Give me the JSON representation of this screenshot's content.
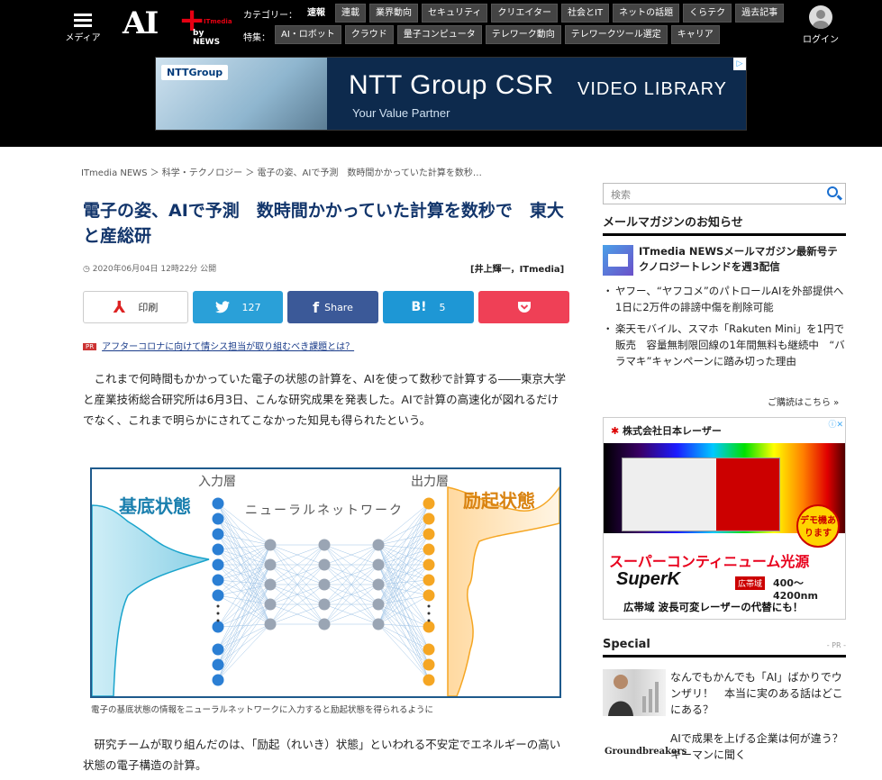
{
  "header": {
    "menu_label": "メディア",
    "logo_text": "AI",
    "logo_plus": "+",
    "logo_itmedia": "ITmedia",
    "logo_by": "by NEWS",
    "category_label": "カテゴリー：",
    "categories": [
      "速報",
      "連載",
      "業界動向",
      "セキュリティ",
      "クリエイター",
      "社会とIT",
      "ネットの話題",
      "くらテク",
      "過去記事"
    ],
    "feature_label": "特集：",
    "features": [
      "AI・ロボット",
      "クラウド",
      "量子コンピュータ",
      "テレワーク動向",
      "テレワークツール選定",
      "キャリア"
    ],
    "login_label": "ログイン"
  },
  "banner": {
    "brand": "NTTGroup",
    "title": "NTT Group CSR",
    "subtitle": "VIDEO LIBRARY",
    "tagline": "Your Value Partner"
  },
  "breadcrumb": "ITmedia NEWS ＞ 科学・テクノロジー ＞ 電子の姿、AIで予測　数時間かかっていた計算を数秒…",
  "article": {
    "title": "電子の姿、AIで予測　数時間かかっていた計算を数秒で　東大と産総研",
    "date": "2020年06月04日 12時22分 公開",
    "author": "[井上輝一，ITmedia]",
    "share": {
      "print": "印刷",
      "twitter_count": "127",
      "facebook": "Share",
      "hatena_count": "5"
    },
    "pr_badge": "PR",
    "pr_link": "アフターコロナに向けて情シス担当が取り組むべき課題とは？",
    "para1": "これまで何時間もかかっていた電子の状態の計算を、AIを使って数秒で計算する――東京大学と産業技術総合研究所は6月3日、こんな研究成果を発表した。AIで計算の高速化が図れるだけでなく、これまで明らかにされてこなかった知見も得られたという。",
    "figure": {
      "input_layer": "入力層",
      "output_layer": "出力層",
      "ground_state": "基底状態",
      "network": "ニューラルネットワーク",
      "excited_state": "励起状態"
    },
    "caption": "電子の基底状態の情報をニューラルネットワークに入力すると励起状態を得られるように",
    "para2": "研究チームが取り組んだのは、「励起（れいき）状態」といわれる不安定でエネルギーの高い状態の電子構造の計算。"
  },
  "sidebar": {
    "search_placeholder": "検索",
    "mail_heading": "メールマガジンのお知らせ",
    "mail_title": "ITmedia NEWSメールマガジン最新号テクノロジートレンドを週3配信",
    "mail_items": [
      "ヤフー、“ヤフコメ”のパトロールAIを外部提供へ　1日に2万件の誹謗中傷を削除可能",
      "楽天モバイル、スマホ「Rakuten Mini」を1円で販売　容量無制限回線の1年間無料も継続中　“バラマキ”キャンペーンに踏み切った理由"
    ],
    "subscribe": "ご購読はこちら »",
    "ad": {
      "company": "株式会社日本レーザー",
      "demo": "デモ機あります",
      "headline": "スーパーコンティニューム光源",
      "product": "SuperK",
      "badge": "広帯域",
      "range": "400～4200nm",
      "footer": "広帯域 波長可変レーザーの代替にも！"
    },
    "special_heading": "Special",
    "special_pr": "- PR -",
    "special_items": [
      "なんでもかんでも「AI」ばかりでウンザリ！　本当に実のある話はどこにある？",
      "AIで成果を上げる企業は何が違う？　キーマンに聞く"
    ],
    "groundbreakers": "Groundbreakers"
  }
}
